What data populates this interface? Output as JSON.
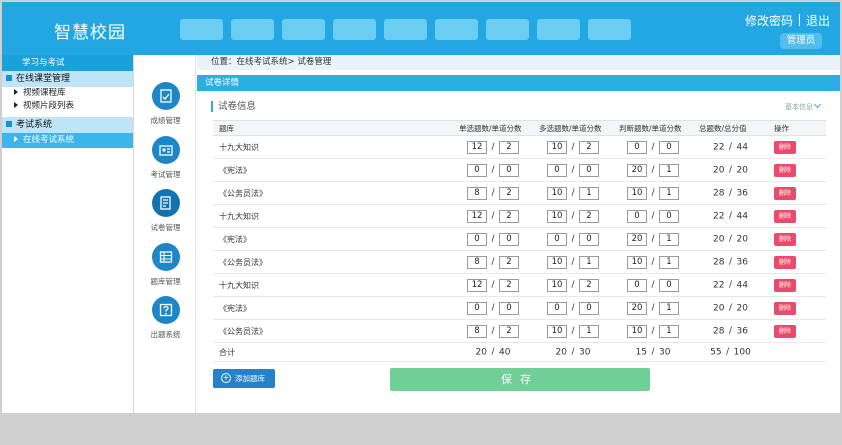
{
  "header": {
    "logo": "智慧校园",
    "change_password": "修改密码",
    "logout": "退出",
    "admin": "管理员",
    "nav_count": 9
  },
  "sidebar": {
    "head": "学习与考试",
    "groups": [
      {
        "label": "在线课堂管理",
        "items": [
          "视频课程库",
          "视频片段列表"
        ]
      },
      {
        "label": "考试系统",
        "items": [
          "在线考试系统"
        ]
      }
    ]
  },
  "iconbar": [
    {
      "label": "成绩管理",
      "icon": "grade-icon"
    },
    {
      "label": "考试管理",
      "icon": "exam-icon"
    },
    {
      "label": "试卷管理",
      "icon": "paper-icon"
    },
    {
      "label": "题库管理",
      "icon": "bank-icon"
    },
    {
      "label": "出题系统",
      "icon": "question-icon"
    }
  ],
  "breadcrumb": "位置：在线考试系统> 试卷管理",
  "title": "试卷详情",
  "section": "试卷信息",
  "basic_info": "基本信息",
  "table": {
    "headers": [
      "题库",
      "单选题数/单道分数",
      "多选题数/单道分数",
      "判断题数/单道分数",
      "总题数/总分值",
      "操作"
    ],
    "rows": [
      {
        "bank": "十九大知识",
        "single": [
          "12",
          "2"
        ],
        "multi": [
          "10",
          "2"
        ],
        "judge": [
          "0",
          "0"
        ],
        "total": [
          "22",
          "44"
        ]
      },
      {
        "bank": "《宪法》",
        "single": [
          "0",
          "0"
        ],
        "multi": [
          "0",
          "0"
        ],
        "judge": [
          "20",
          "1"
        ],
        "total": [
          "20",
          "20"
        ]
      },
      {
        "bank": "《公务员法》",
        "single": [
          "8",
          "2"
        ],
        "multi": [
          "10",
          "1"
        ],
        "judge": [
          "10",
          "1"
        ],
        "total": [
          "28",
          "36"
        ]
      },
      {
        "bank": "十九大知识",
        "single": [
          "12",
          "2"
        ],
        "multi": [
          "10",
          "2"
        ],
        "judge": [
          "0",
          "0"
        ],
        "total": [
          "22",
          "44"
        ]
      },
      {
        "bank": "《宪法》",
        "single": [
          "0",
          "0"
        ],
        "multi": [
          "0",
          "0"
        ],
        "judge": [
          "20",
          "1"
        ],
        "total": [
          "20",
          "20"
        ]
      },
      {
        "bank": "《公务员法》",
        "single": [
          "8",
          "2"
        ],
        "multi": [
          "10",
          "1"
        ],
        "judge": [
          "10",
          "1"
        ],
        "total": [
          "28",
          "36"
        ]
      },
      {
        "bank": "十九大知识",
        "single": [
          "12",
          "2"
        ],
        "multi": [
          "10",
          "2"
        ],
        "judge": [
          "0",
          "0"
        ],
        "total": [
          "22",
          "44"
        ]
      },
      {
        "bank": "《宪法》",
        "single": [
          "0",
          "0"
        ],
        "multi": [
          "0",
          "0"
        ],
        "judge": [
          "20",
          "1"
        ],
        "total": [
          "20",
          "20"
        ]
      },
      {
        "bank": "《公务员法》",
        "single": [
          "8",
          "2"
        ],
        "multi": [
          "10",
          "1"
        ],
        "judge": [
          "10",
          "1"
        ],
        "total": [
          "28",
          "36"
        ]
      }
    ],
    "delete_label": "删除",
    "sum": {
      "label": "合计",
      "single": [
        "20",
        "40"
      ],
      "multi": [
        "20",
        "30"
      ],
      "judge": [
        "15",
        "30"
      ],
      "total": [
        "55",
        "100"
      ]
    }
  },
  "add_button": "添加题库",
  "save_button": "保存",
  "colors": {
    "header": "#22a7e3",
    "accent": "#1d86c7",
    "delete": "#ea4a6b",
    "save": "#6fcf97"
  }
}
